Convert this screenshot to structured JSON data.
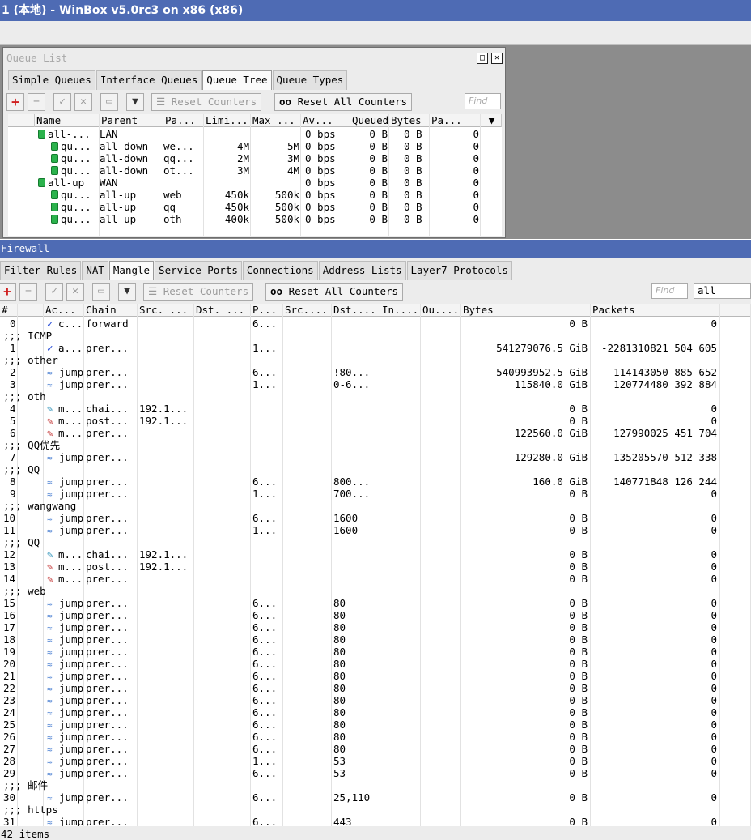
{
  "app": {
    "title": "1 (本地) - WinBox v5.0rc3 on x86 (x86)"
  },
  "queue": {
    "window_title": "Queue List",
    "tabs": [
      "Simple Queues",
      "Interface Queues",
      "Queue Tree",
      "Queue Types"
    ],
    "active_tab": 2,
    "reset_counters": "Reset Counters",
    "reset_all_counters": "Reset All Counters",
    "find_placeholder": "Find",
    "columns": [
      "Name",
      "Parent",
      "Pa...",
      "Limi...",
      "Max ...",
      "Av...",
      "Queued...",
      "Bytes",
      "Pa..."
    ],
    "rows": [
      {
        "indent": 0,
        "name": "all-...",
        "parent": "LAN",
        "packet_mark": "",
        "limit": "",
        "max": "",
        "avg": "0 bps",
        "queued": "0 B",
        "bytes": "0 B",
        "packets": "0"
      },
      {
        "indent": 1,
        "name": "qu...",
        "parent": "all-down",
        "packet_mark": "we...",
        "limit": "4M",
        "max": "5M",
        "avg": "0 bps",
        "queued": "0 B",
        "bytes": "0 B",
        "packets": "0"
      },
      {
        "indent": 1,
        "name": "qu...",
        "parent": "all-down",
        "packet_mark": "qq...",
        "limit": "2M",
        "max": "3M",
        "avg": "0 bps",
        "queued": "0 B",
        "bytes": "0 B",
        "packets": "0"
      },
      {
        "indent": 1,
        "name": "qu...",
        "parent": "all-down",
        "packet_mark": "ot...",
        "limit": "3M",
        "max": "4M",
        "avg": "0 bps",
        "queued": "0 B",
        "bytes": "0 B",
        "packets": "0"
      },
      {
        "indent": 0,
        "name": "all-up",
        "parent": "WAN",
        "packet_mark": "",
        "limit": "",
        "max": "",
        "avg": "0 bps",
        "queued": "0 B",
        "bytes": "0 B",
        "packets": "0"
      },
      {
        "indent": 1,
        "name": "qu...",
        "parent": "all-up",
        "packet_mark": "web",
        "limit": "450k",
        "max": "500k",
        "avg": "0 bps",
        "queued": "0 B",
        "bytes": "0 B",
        "packets": "0"
      },
      {
        "indent": 1,
        "name": "qu...",
        "parent": "all-up",
        "packet_mark": "qq",
        "limit": "450k",
        "max": "500k",
        "avg": "0 bps",
        "queued": "0 B",
        "bytes": "0 B",
        "packets": "0"
      },
      {
        "indent": 1,
        "name": "qu...",
        "parent": "all-up",
        "packet_mark": "oth",
        "limit": "400k",
        "max": "500k",
        "avg": "0 bps",
        "queued": "0 B",
        "bytes": "0 B",
        "packets": "0"
      }
    ]
  },
  "firewall": {
    "window_title": "Firewall",
    "tabs": [
      "Filter Rules",
      "NAT",
      "Mangle",
      "Service Ports",
      "Connections",
      "Address Lists",
      "Layer7 Protocols"
    ],
    "active_tab": 2,
    "reset_counters": "Reset Counters",
    "reset_all_counters": "Reset All Counters",
    "find_placeholder": "Find",
    "filter_value": "all",
    "columns": [
      "#",
      "Ac...",
      "Chain",
      "Src. ...",
      "Dst. ...",
      "P...",
      "Src....",
      "Dst....",
      "In....",
      "Ou....",
      "Bytes",
      "Packets"
    ],
    "rows": [
      {
        "type": "rule",
        "num": "0",
        "icon": "check",
        "action": "c...",
        "chain": "forward",
        "src": "",
        "dst": "",
        "proto": "6...",
        "sport": "",
        "dport": "",
        "bytes": "0 B",
        "packets": "0"
      },
      {
        "type": "comment",
        "text": ";;; ICMP"
      },
      {
        "type": "rule",
        "num": "1",
        "icon": "check",
        "action": "a...",
        "chain": "prer...",
        "src": "",
        "dst": "",
        "proto": "1...",
        "sport": "",
        "dport": "",
        "bytes": "541279076.5 GiB",
        "packets": "-2281310821 504 605"
      },
      {
        "type": "comment",
        "text": ";;; other"
      },
      {
        "type": "rule",
        "num": "2",
        "icon": "jump",
        "action": "jump",
        "chain": "prer...",
        "src": "",
        "dst": "",
        "proto": "6...",
        "sport": "",
        "dport": "!80...",
        "bytes": "540993952.5 GiB",
        "packets": "114143050 885 652"
      },
      {
        "type": "rule",
        "num": "3",
        "icon": "jump",
        "action": "jump",
        "chain": "prer...",
        "src": "",
        "dst": "",
        "proto": "1...",
        "sport": "",
        "dport": "0-6...",
        "bytes": "115840.0 GiB",
        "packets": "120774480 392 884"
      },
      {
        "type": "comment",
        "text": ";;; oth"
      },
      {
        "type": "rule",
        "num": "4",
        "icon": "mark2",
        "action": "m...",
        "chain": "chai...",
        "src": "192.1...",
        "dst": "",
        "proto": "",
        "sport": "",
        "dport": "",
        "bytes": "0 B",
        "packets": "0"
      },
      {
        "type": "rule",
        "num": "5",
        "icon": "mark",
        "action": "m...",
        "chain": "post...",
        "src": "192.1...",
        "dst": "",
        "proto": "",
        "sport": "",
        "dport": "",
        "bytes": "0 B",
        "packets": "0"
      },
      {
        "type": "rule",
        "num": "6",
        "icon": "mark",
        "action": "m...",
        "chain": "prer...",
        "src": "",
        "dst": "",
        "proto": "",
        "sport": "",
        "dport": "",
        "bytes": "122560.0 GiB",
        "packets": "127990025 451 704"
      },
      {
        "type": "comment",
        "text": ";;; QQ优先"
      },
      {
        "type": "rule",
        "num": "7",
        "icon": "jump",
        "action": "jump",
        "chain": "prer...",
        "src": "",
        "dst": "",
        "proto": "",
        "sport": "",
        "dport": "",
        "bytes": "129280.0 GiB",
        "packets": "135205570 512 338"
      },
      {
        "type": "comment",
        "text": ";;; QQ"
      },
      {
        "type": "rule",
        "num": "8",
        "icon": "jump",
        "action": "jump",
        "chain": "prer...",
        "src": "",
        "dst": "",
        "proto": "6...",
        "sport": "",
        "dport": "800...",
        "bytes": "160.0 GiB",
        "packets": "140771848 126 244"
      },
      {
        "type": "rule",
        "num": "9",
        "icon": "jump",
        "action": "jump",
        "chain": "prer...",
        "src": "",
        "dst": "",
        "proto": "1...",
        "sport": "",
        "dport": "700...",
        "bytes": "0 B",
        "packets": "0"
      },
      {
        "type": "comment",
        "text": ";;; wangwang"
      },
      {
        "type": "rule",
        "num": "10",
        "icon": "jump",
        "action": "jump",
        "chain": "prer...",
        "src": "",
        "dst": "",
        "proto": "6...",
        "sport": "",
        "dport": "1600",
        "bytes": "0 B",
        "packets": "0"
      },
      {
        "type": "rule",
        "num": "11",
        "icon": "jump",
        "action": "jump",
        "chain": "prer...",
        "src": "",
        "dst": "",
        "proto": "1...",
        "sport": "",
        "dport": "1600",
        "bytes": "0 B",
        "packets": "0"
      },
      {
        "type": "comment",
        "text": ";;; QQ"
      },
      {
        "type": "rule",
        "num": "12",
        "icon": "mark2",
        "action": "m...",
        "chain": "chai...",
        "src": "192.1...",
        "dst": "",
        "proto": "",
        "sport": "",
        "dport": "",
        "bytes": "0 B",
        "packets": "0"
      },
      {
        "type": "rule",
        "num": "13",
        "icon": "mark",
        "action": "m...",
        "chain": "post...",
        "src": "192.1...",
        "dst": "",
        "proto": "",
        "sport": "",
        "dport": "",
        "bytes": "0 B",
        "packets": "0"
      },
      {
        "type": "rule",
        "num": "14",
        "icon": "mark",
        "action": "m...",
        "chain": "prer...",
        "src": "",
        "dst": "",
        "proto": "",
        "sport": "",
        "dport": "",
        "bytes": "0 B",
        "packets": "0"
      },
      {
        "type": "comment",
        "text": ";;; web"
      },
      {
        "type": "rule",
        "num": "15",
        "icon": "jump",
        "action": "jump",
        "chain": "prer...",
        "src": "",
        "dst": "",
        "proto": "6...",
        "sport": "",
        "dport": "80",
        "bytes": "0 B",
        "packets": "0"
      },
      {
        "type": "rule",
        "num": "16",
        "icon": "jump",
        "action": "jump",
        "chain": "prer...",
        "src": "",
        "dst": "",
        "proto": "6...",
        "sport": "",
        "dport": "80",
        "bytes": "0 B",
        "packets": "0"
      },
      {
        "type": "rule",
        "num": "17",
        "icon": "jump",
        "action": "jump",
        "chain": "prer...",
        "src": "",
        "dst": "",
        "proto": "6...",
        "sport": "",
        "dport": "80",
        "bytes": "0 B",
        "packets": "0"
      },
      {
        "type": "rule",
        "num": "18",
        "icon": "jump",
        "action": "jump",
        "chain": "prer...",
        "src": "",
        "dst": "",
        "proto": "6...",
        "sport": "",
        "dport": "80",
        "bytes": "0 B",
        "packets": "0"
      },
      {
        "type": "rule",
        "num": "19",
        "icon": "jump",
        "action": "jump",
        "chain": "prer...",
        "src": "",
        "dst": "",
        "proto": "6...",
        "sport": "",
        "dport": "80",
        "bytes": "0 B",
        "packets": "0"
      },
      {
        "type": "rule",
        "num": "20",
        "icon": "jump",
        "action": "jump",
        "chain": "prer...",
        "src": "",
        "dst": "",
        "proto": "6...",
        "sport": "",
        "dport": "80",
        "bytes": "0 B",
        "packets": "0"
      },
      {
        "type": "rule",
        "num": "21",
        "icon": "jump",
        "action": "jump",
        "chain": "prer...",
        "src": "",
        "dst": "",
        "proto": "6...",
        "sport": "",
        "dport": "80",
        "bytes": "0 B",
        "packets": "0"
      },
      {
        "type": "rule",
        "num": "22",
        "icon": "jump",
        "action": "jump",
        "chain": "prer...",
        "src": "",
        "dst": "",
        "proto": "6...",
        "sport": "",
        "dport": "80",
        "bytes": "0 B",
        "packets": "0"
      },
      {
        "type": "rule",
        "num": "23",
        "icon": "jump",
        "action": "jump",
        "chain": "prer...",
        "src": "",
        "dst": "",
        "proto": "6...",
        "sport": "",
        "dport": "80",
        "bytes": "0 B",
        "packets": "0"
      },
      {
        "type": "rule",
        "num": "24",
        "icon": "jump",
        "action": "jump",
        "chain": "prer...",
        "src": "",
        "dst": "",
        "proto": "6...",
        "sport": "",
        "dport": "80",
        "bytes": "0 B",
        "packets": "0"
      },
      {
        "type": "rule",
        "num": "25",
        "icon": "jump",
        "action": "jump",
        "chain": "prer...",
        "src": "",
        "dst": "",
        "proto": "6...",
        "sport": "",
        "dport": "80",
        "bytes": "0 B",
        "packets": "0"
      },
      {
        "type": "rule",
        "num": "26",
        "icon": "jump",
        "action": "jump",
        "chain": "prer...",
        "src": "",
        "dst": "",
        "proto": "6...",
        "sport": "",
        "dport": "80",
        "bytes": "0 B",
        "packets": "0"
      },
      {
        "type": "rule",
        "num": "27",
        "icon": "jump",
        "action": "jump",
        "chain": "prer...",
        "src": "",
        "dst": "",
        "proto": "6...",
        "sport": "",
        "dport": "80",
        "bytes": "0 B",
        "packets": "0"
      },
      {
        "type": "rule",
        "num": "28",
        "icon": "jump",
        "action": "jump",
        "chain": "prer...",
        "src": "",
        "dst": "",
        "proto": "1...",
        "sport": "",
        "dport": "53",
        "bytes": "0 B",
        "packets": "0"
      },
      {
        "type": "rule",
        "num": "29",
        "icon": "jump",
        "action": "jump",
        "chain": "prer...",
        "src": "",
        "dst": "",
        "proto": "6...",
        "sport": "",
        "dport": "53",
        "bytes": "0 B",
        "packets": "0"
      },
      {
        "type": "comment",
        "text": ";;; 邮件"
      },
      {
        "type": "rule",
        "num": "30",
        "icon": "jump",
        "action": "jump",
        "chain": "prer...",
        "src": "",
        "dst": "",
        "proto": "6...",
        "sport": "",
        "dport": "25,110",
        "bytes": "0 B",
        "packets": "0"
      },
      {
        "type": "comment",
        "text": ";;; https"
      },
      {
        "type": "rule",
        "num": "31",
        "icon": "jump",
        "action": "jump",
        "chain": "prer...",
        "src": "",
        "dst": "",
        "proto": "6...",
        "sport": "",
        "dport": "443",
        "bytes": "0 B",
        "packets": "0"
      }
    ],
    "status": "42 items"
  },
  "colors": {
    "titlebar": "#4e6bb4",
    "add_icon": "#d02020",
    "workspace": "#8c8c8c"
  },
  "icons": {
    "add": "plus-icon",
    "remove": "minus-icon",
    "enable": "check-icon",
    "disable": "cross-icon",
    "comment": "note-icon",
    "filter": "filter-icon",
    "queue": "queue-icon",
    "accept": "check-icon",
    "jump": "jump-icon",
    "mark": "pen-icon"
  }
}
